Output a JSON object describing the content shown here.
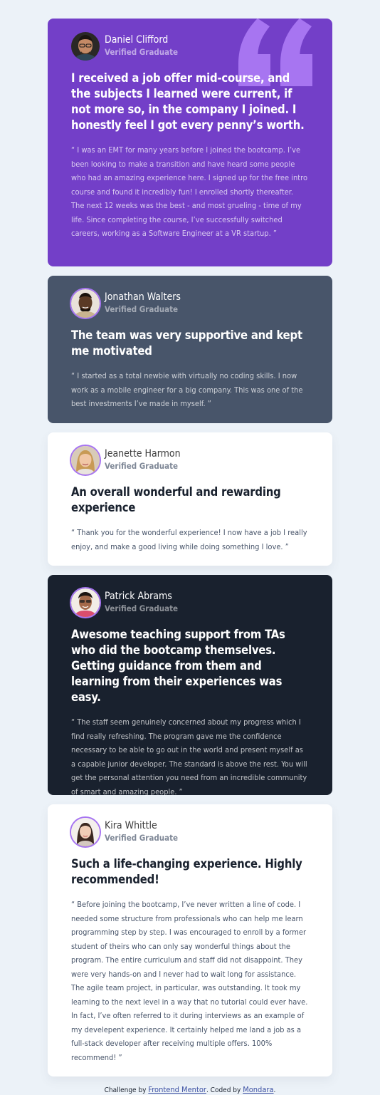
{
  "testimonials": [
    {
      "name": "Daniel Clifford",
      "status": "Verified Graduate",
      "headline": "I received a job offer mid-course, and the subjects I learned were current, if not more so, in the company I joined. I honestly feel I got every penny’s worth.",
      "quote": "“ I was an EMT for many years before I joined the bootcamp. I’ve been looking to make a transition and have heard some people who had an amazing experience here. I signed up for the free intro course and found it incredibly fun! I enrolled shortly thereafter. The next 12 weeks was the best - and most grueling - time of my life. Since completing the course, I’ve successfully switched careers, working as a Software Engineer at a VR startup. ”",
      "theme": "#733fc8"
    },
    {
      "name": "Jonathan Walters",
      "status": "Verified Graduate",
      "headline": "The team was very supportive and kept me motivated",
      "quote": "“ I started as a total newbie with virtually no coding skills. I now work as a mobile engineer for a big company. This was one of the best investments I’ve made in myself. ”",
      "theme": "#48556a"
    },
    {
      "name": "Jeanette Harmon",
      "status": "Verified Graduate",
      "headline": "An overall wonderful and rewarding experience",
      "quote": "“ Thank you for the wonderful experience! I now have a job I really enjoy, and make a good living while doing something I love. ”",
      "theme": "#ffffff"
    },
    {
      "name": "Patrick Abrams",
      "status": "Verified Graduate",
      "headline": "Awesome teaching support from TAs who did the bootcamp themselves. Getting guidance from them and learning from their experiences was easy.",
      "quote": "“ The staff seem genuinely concerned about my progress which I find really refreshing. The program gave me the confidence necessary to be able to go out in the world and present myself as a capable junior developer. The standard is above the rest. You will get the personal attention you need from an incredible community of smart and amazing people. ”",
      "theme": "#19212e"
    },
    {
      "name": "Kira Whittle",
      "status": "Verified Graduate",
      "headline": "Such a life-changing experience. Highly recommended!",
      "quote": "“ Before joining the bootcamp, I’ve never written a line of code. I needed some structure from professionals who can help me learn programming step by step. I was encouraged to enroll by a former student of theirs who can only say wonderful things about the program. The entire curriculum and staff did not disappoint. They were very hands-on and I never had to wait long for assistance. The agile team project, in particular, was outstanding. It took my learning to the next level in a way that no tutorial could ever have. In fact, I’ve often referred to it during interviews as an example of my develepent experience. It certainly helped me land a job as a full-stack developer after receiving multiple offers. 100% recommend! ”",
      "theme": "#ffffff"
    }
  ],
  "footer": {
    "challenge_prefix": "Challenge by",
    "challenge_link": "Frontend Mentor",
    "coded_prefix": ". Coded by",
    "coded_link": "Mondara",
    "suffix": "."
  },
  "icons": {
    "quote": "quotation-mark-icon",
    "avatar": "avatar-photo"
  },
  "colors": {
    "page_background": "#ecf2f8",
    "purple": "#733fc8",
    "slate": "#48556a",
    "dark": "#19212e",
    "avatar_border": "#a775f1",
    "link": "#3e52a3"
  }
}
